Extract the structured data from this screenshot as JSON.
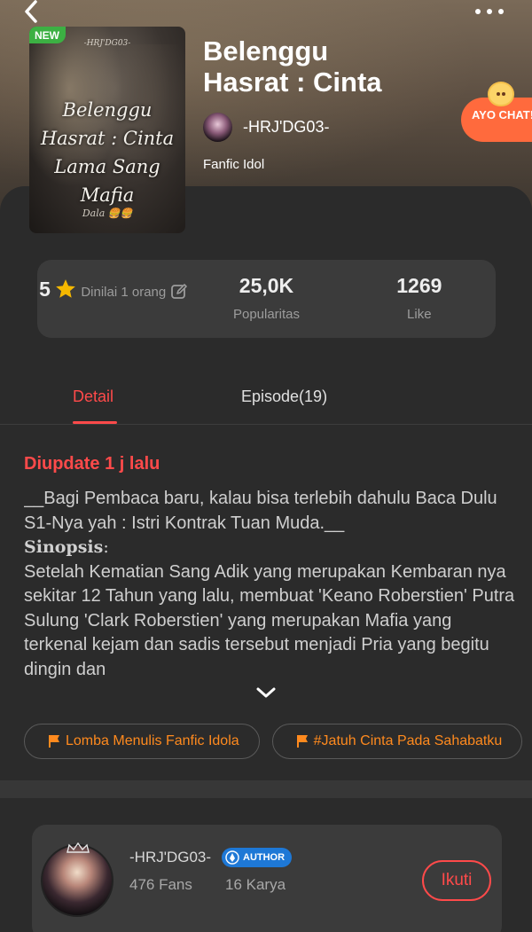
{
  "book": {
    "title": "Belenggu\nHasrat : Cinta",
    "author": "-HRJ'DG03-",
    "genre": "Fanfic Idol",
    "new_badge": "NEW",
    "cover": {
      "top_text": "-HRJ'DG03-",
      "title": "Belenggu\nHasrat : Cinta\nLama Sang\nMafia",
      "sign": "Dala 🍔🍔"
    }
  },
  "chat_badge": {
    "label": "AYO CHAT!"
  },
  "stats": {
    "rating_value": "5",
    "rating_label": "Dinilai 1 orang",
    "popularity_value": "25,0K",
    "popularity_label": "Popularitas",
    "likes_value": "1269",
    "likes_label": "Like"
  },
  "tabs": {
    "detail": "Detail",
    "episodes": "Episode(19)"
  },
  "detail": {
    "updated": "Diupdate 1 j lalu",
    "intro": "__Bagi Pembaca baru, kalau bisa terlebih dahulu Baca Dulu S1-Nya yah : Istri Kontrak Tuan Muda.__",
    "synopsis_label": "Sinopsis",
    "synopsis_colon": ":",
    "synopsis": "Setelah Kematian Sang Adik yang merupakan Kembaran nya sekitar 12 Tahun yang lalu, membuat 'Keano Roberstien' Putra Sulung 'Clark Roberstien' yang merupakan Mafia yang terkenal kejam dan sadis tersebut menjadi Pria yang begitu dingin dan"
  },
  "tags": [
    "Lomba Menulis Fanfic Idola",
    "#Jatuh Cinta Pada Sahabatku"
  ],
  "author_card": {
    "name": "-HRJ'DG03-",
    "badge": "AUTHOR",
    "fans": "476 Fans",
    "works": "16 Karya",
    "follow_label": "Ikuti"
  },
  "colors": {
    "accent": "#ff4a4a",
    "tag": "#ff8a1e",
    "star": "#f5b800",
    "author_badge": "#1e78d6",
    "new_badge": "#3cb043"
  }
}
